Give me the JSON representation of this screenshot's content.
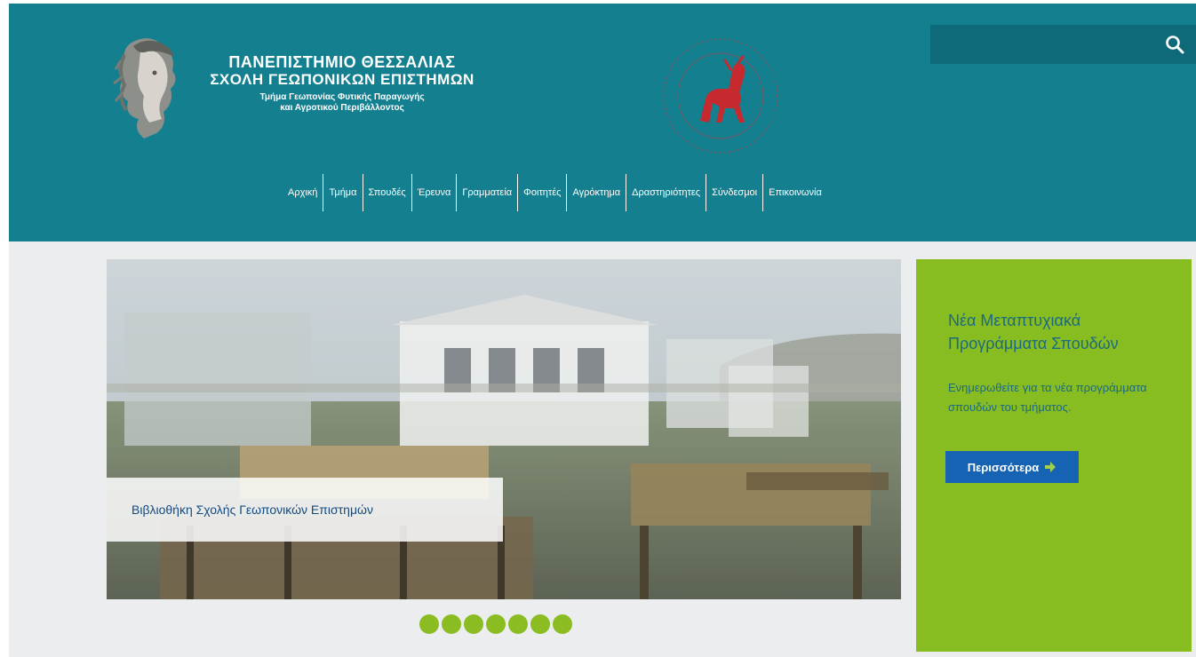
{
  "header": {
    "university": "ΠΑΝΕΠΙΣΤΗΜΙΟ ΘΕΣΣΑΛΙΑΣ",
    "school": "ΣΧΟΛΗ ΓΕΩΠΟΝΙΚΩΝ ΕΠΙΣΤΗΜΩΝ",
    "department_line1": "Τμήμα Γεωπονίας Φυτικής Παραγωγής",
    "department_line2": "και Αγροτικού Περιβάλλοντος"
  },
  "search": {
    "placeholder": "",
    "icon": "search-icon"
  },
  "nav": {
    "items": [
      {
        "label": "Αρχική"
      },
      {
        "label": "Τμήμα"
      },
      {
        "label": "Σπουδές"
      },
      {
        "label": "Έρευνα"
      },
      {
        "label": "Γραμματεία"
      },
      {
        "label": "Φοιτητές"
      },
      {
        "label": "Αγρόκτημα"
      },
      {
        "label": "Δραστηριότητες"
      },
      {
        "label": "Σύνδεσμοι"
      },
      {
        "label": "Επικοινωνία"
      }
    ]
  },
  "slider": {
    "caption": "Βιβλιοθήκη Σχολής Γεωπονικών Επιστημών",
    "dots_count": 7
  },
  "promo": {
    "title": "Νέα Μεταπτυχιακά Προγράμματα Σπουδών",
    "text": "Ενημερωθείτε για τα νέα προγράμματα σπουδών του τμήματος.",
    "button_label": "Περισσότερα"
  },
  "colors": {
    "header_bg": "#147f8f",
    "accent_green": "#88bd22",
    "button_blue": "#1663b4",
    "caption_blue": "#154a80"
  }
}
